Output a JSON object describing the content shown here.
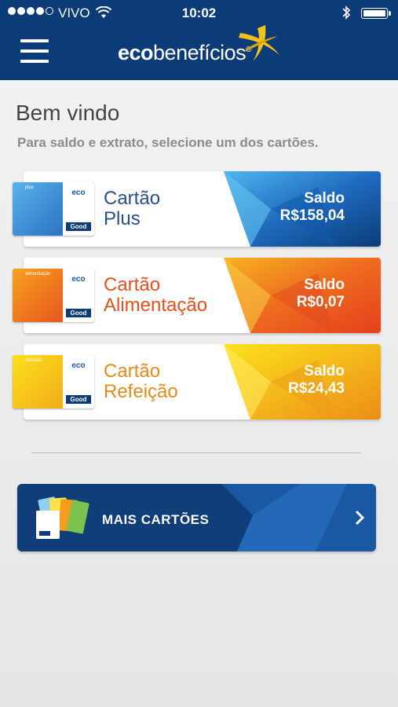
{
  "status_bar": {
    "carrier": "VIVO",
    "time": "10:02"
  },
  "header": {
    "logo_bold": "eco",
    "logo_light": "benefícios",
    "menu_icon": "hamburger-menu-icon",
    "colors": {
      "header_bg": "#0b3c78"
    }
  },
  "main": {
    "welcome": "Bem vindo",
    "instruction": "Para saldo e extrato, selecione um dos cartões.",
    "cards": [
      {
        "name_line1": "Cartão",
        "name_line2": "Plus",
        "saldo_label": "Saldo",
        "saldo_value": "R$158,04",
        "card_eco": "eco",
        "card_good": "Good",
        "card_tiny": "plus",
        "accent": "#1f6bbf"
      },
      {
        "name_line1": "Cartão",
        "name_line2": "Alimentação",
        "saldo_label": "Saldo",
        "saldo_value": "R$0,07",
        "card_eco": "eco",
        "card_good": "Good",
        "card_tiny": "alimentação",
        "accent": "#e6541f"
      },
      {
        "name_line1": "Cartão",
        "name_line2": "Refeição",
        "saldo_label": "Saldo",
        "saldo_value": "R$24,43",
        "card_eco": "eco",
        "card_good": "Good",
        "card_tiny": "refeição",
        "accent": "#e59a1a"
      }
    ],
    "more_cards": {
      "label": "MAIS CARTÕES",
      "icon": "chevron-right-icon"
    }
  }
}
